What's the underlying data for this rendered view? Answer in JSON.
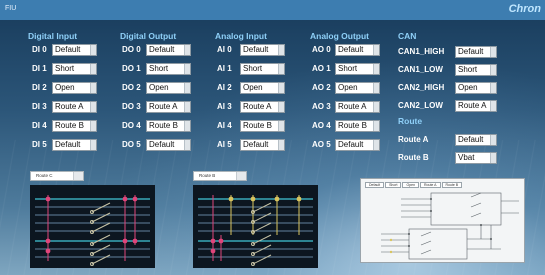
{
  "window": {
    "title": "FIU",
    "brand": "Chron"
  },
  "headers": {
    "digital_input": "Digital Input",
    "digital_output": "Digital Output",
    "analog_input": "Analog Input",
    "analog_output": "Analog Output",
    "can": "CAN",
    "route": "Route"
  },
  "digital_inputs": [
    {
      "label": "DI 0",
      "value": "Default"
    },
    {
      "label": "DI 1",
      "value": "Short"
    },
    {
      "label": "DI 2",
      "value": "Open"
    },
    {
      "label": "DI 3",
      "value": "Route A"
    },
    {
      "label": "DI 4",
      "value": "Route B"
    },
    {
      "label": "DI 5",
      "value": "Default"
    }
  ],
  "digital_outputs": [
    {
      "label": "DO 0",
      "value": "Default"
    },
    {
      "label": "DO 1",
      "value": "Short"
    },
    {
      "label": "DO 2",
      "value": "Open"
    },
    {
      "label": "DO 3",
      "value": "Route A"
    },
    {
      "label": "DO 4",
      "value": "Route B"
    },
    {
      "label": "DO 5",
      "value": "Default"
    }
  ],
  "analog_inputs": [
    {
      "label": "AI 0",
      "value": "Default"
    },
    {
      "label": "AI 1",
      "value": "Short"
    },
    {
      "label": "AI 2",
      "value": "Open"
    },
    {
      "label": "AI 3",
      "value": "Route A"
    },
    {
      "label": "AI 4",
      "value": "Route B"
    },
    {
      "label": "AI 5",
      "value": "Default"
    }
  ],
  "analog_outputs": [
    {
      "label": "AO 0",
      "value": "Default"
    },
    {
      "label": "AO 1",
      "value": "Short"
    },
    {
      "label": "AO 2",
      "value": "Open"
    },
    {
      "label": "AO 3",
      "value": "Route A"
    },
    {
      "label": "AO 4",
      "value": "Route B"
    },
    {
      "label": "AO 5",
      "value": "Default"
    }
  ],
  "can": [
    {
      "label": "CAN1_HIGH",
      "value": "Default"
    },
    {
      "label": "CAN1_LOW",
      "value": "Short"
    },
    {
      "label": "CAN2_HIGH",
      "value": "Open"
    },
    {
      "label": "CAN2_LOW",
      "value": "Route A"
    }
  ],
  "route": [
    {
      "label": "Route A",
      "value": "Default"
    },
    {
      "label": "Route B",
      "value": "Vbat"
    }
  ],
  "panels": [
    {
      "selector": "Route C"
    },
    {
      "selector": "Route B"
    }
  ],
  "schematic": {
    "tabs": [
      "Default",
      "Short",
      "Open",
      "Route A",
      "Route B"
    ]
  },
  "colors": {
    "titlebar": "#3d7db0",
    "header_text": "#8fd0f8",
    "bus_cyan": "#41c6d6",
    "node_pink": "#e0457a",
    "node_yellow": "#d8c45e",
    "switch_stroke": "#c8c4a6"
  }
}
